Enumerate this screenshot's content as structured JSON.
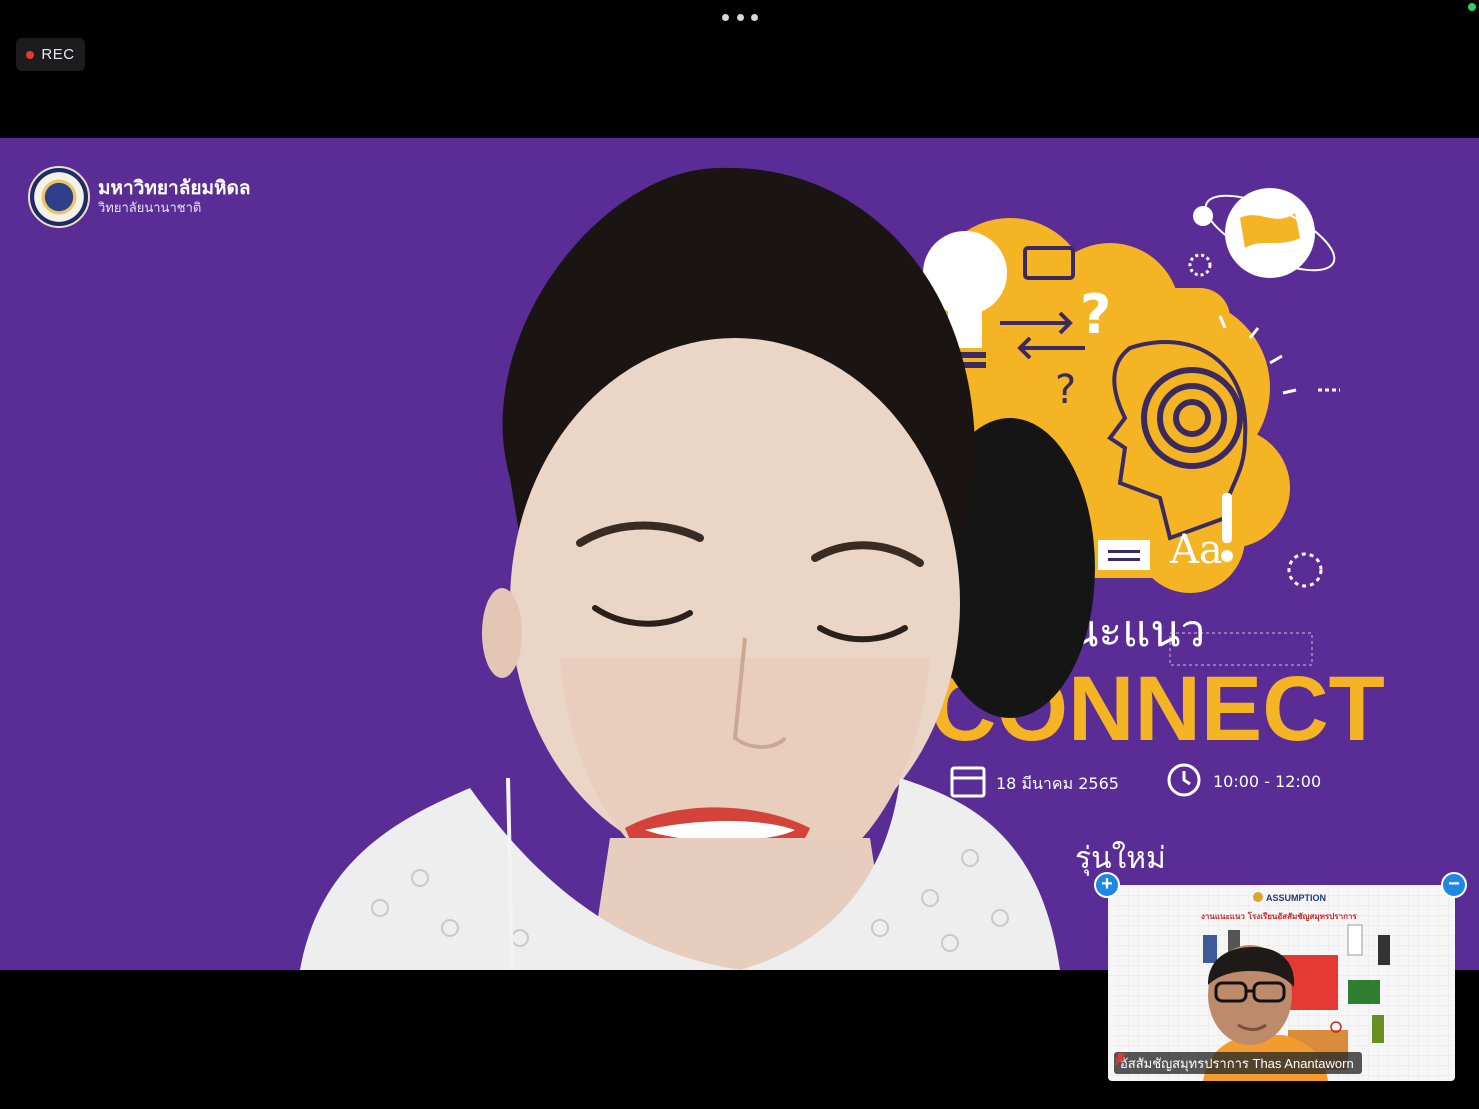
{
  "recording": {
    "label": "REC"
  },
  "colors": {
    "rec_dot": "#e53935",
    "backdrop": "#5a2c96",
    "accent": "#f5b423",
    "pip_button": "#1e88e5",
    "status_dot": "#2fd35a"
  },
  "icons": [
    "more-options-icon",
    "record-dot-icon",
    "university-seal-icon",
    "lightbulb-icon",
    "globe-icon",
    "target-head-icon",
    "calendar-icon",
    "clock-icon",
    "expand-plus-icon",
    "minimize-minus-icon",
    "mic-muted-icon"
  ],
  "main_video": {
    "logo_university": "มหาวิทยาลัยมหิดล",
    "logo_college": "วิทยาลัยนานาชาติ",
    "banner_word1": "แนะแนว",
    "banner_word2": "CONNECT",
    "event_date": "18 มีนาคม 2565",
    "event_time": "10:00 - 12:00",
    "banner_tagline": "รุ่นใหม่"
  },
  "thumbnail": {
    "participant_name": "อัสสัมชัญสมุทรปราการ Thas Anantaworn",
    "slide_header": "ASSUMPTION",
    "slide_title": "งานแนะแนว โรงเรียนอัสสัมชัญสมุทรปราการ"
  }
}
